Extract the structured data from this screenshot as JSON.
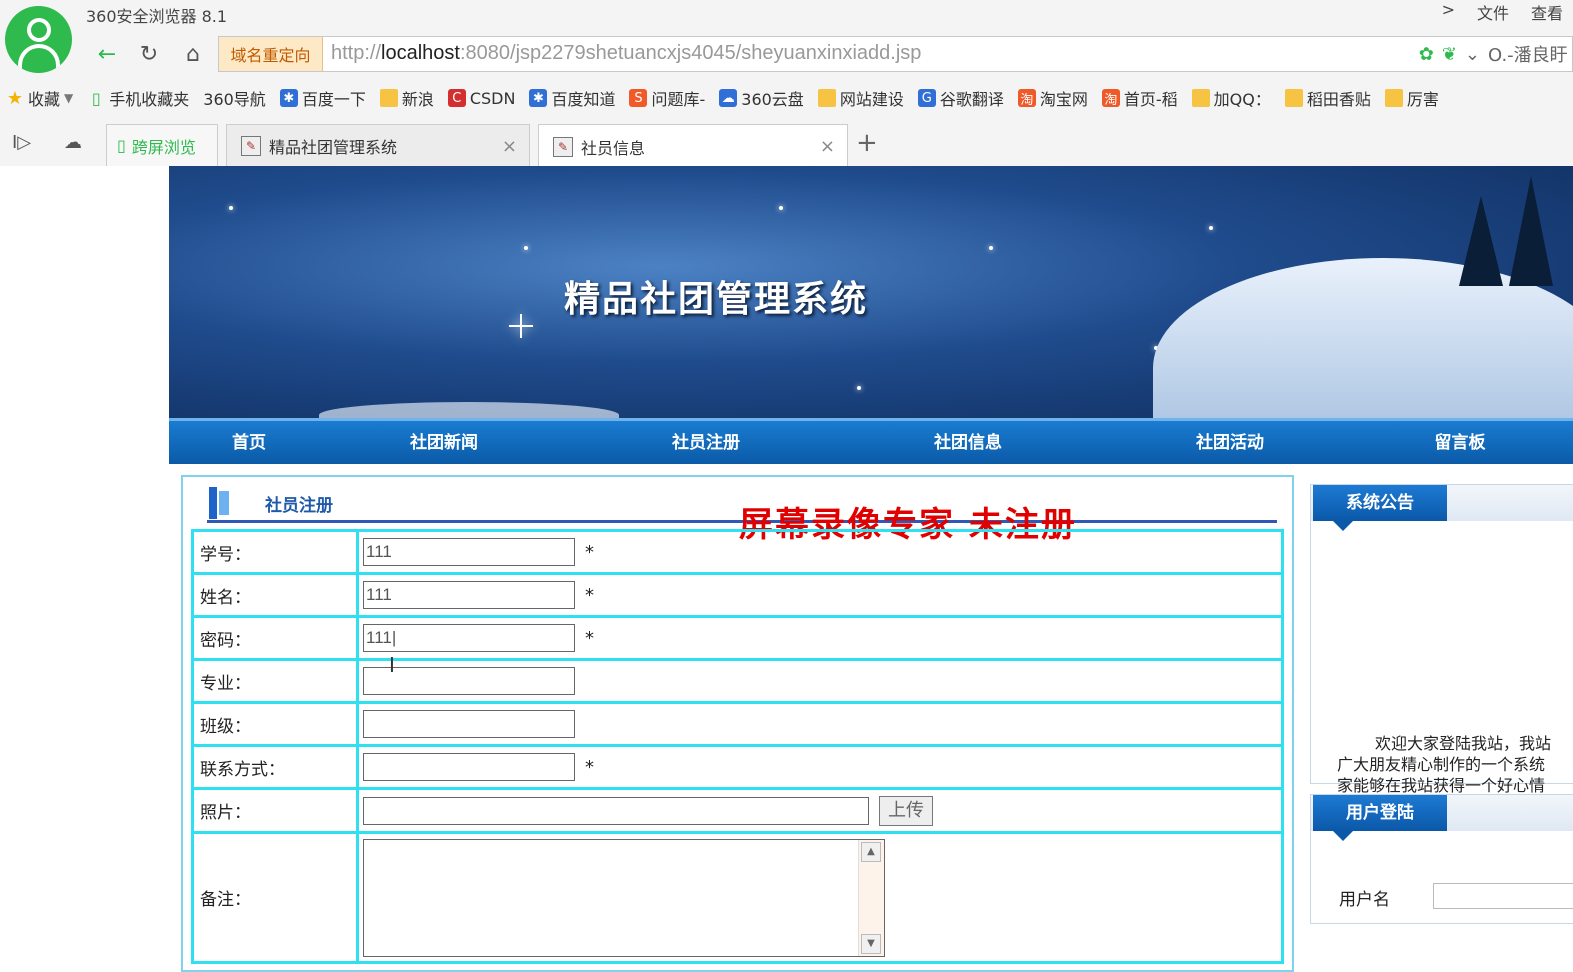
{
  "browser": {
    "title": "360安全浏览器 8.1",
    "menu": [
      ">",
      "文件",
      "查看"
    ],
    "redirect_label": "域名重定向",
    "url_prefix": "http://",
    "url_host": "localhost",
    "url_rest": ":8080/jsp2279shetuancxjs4045/sheyuanxinxiadd.jsp",
    "search_hint": "O.-潘良盱",
    "bookmarks": [
      {
        "label": "收藏",
        "icon": "star-icon"
      },
      {
        "label": "手机收藏夹",
        "icon": "phone-icon"
      },
      {
        "label": "360导航",
        "icon": "page-icon"
      },
      {
        "label": "百度一下",
        "icon": "baidu-icon"
      },
      {
        "label": "新浪",
        "icon": "folder-icon"
      },
      {
        "label": "CSDN",
        "icon": "csdn-icon"
      },
      {
        "label": "百度知道",
        "icon": "baidu-icon"
      },
      {
        "label": "问题库-",
        "icon": "sogou-icon"
      },
      {
        "label": "360云盘",
        "icon": "cloud-icon"
      },
      {
        "label": "网站建设",
        "icon": "folder-icon"
      },
      {
        "label": "谷歌翻译",
        "icon": "translate-icon"
      },
      {
        "label": "淘宝网",
        "icon": "taobao-icon"
      },
      {
        "label": "首页-稻",
        "icon": "taobao-icon"
      },
      {
        "label": "加QQ：",
        "icon": "folder-icon"
      },
      {
        "label": "稻田香贴",
        "icon": "folder-icon"
      },
      {
        "label": "厉害",
        "icon": "folder-icon"
      }
    ],
    "tabs": [
      {
        "label": "跨屏浏览"
      },
      {
        "label": "精品社团管理系统"
      },
      {
        "label": "社员信息"
      }
    ]
  },
  "site": {
    "title": "精品社团管理系统",
    "nav": [
      "首页",
      "社团新闻",
      "社员注册",
      "社团信息",
      "社团活动",
      "留言板"
    ],
    "section_title": "社员注册",
    "watermark": "屏幕录像专家 未注册"
  },
  "form": {
    "rows": [
      {
        "label": "学号：",
        "value": "111",
        "required": "*"
      },
      {
        "label": "姓名：",
        "value": "111",
        "required": "*"
      },
      {
        "label": "密码：",
        "value": "111|",
        "required": "*"
      },
      {
        "label": "专业：",
        "value": "",
        "required": ""
      },
      {
        "label": "班级：",
        "value": "",
        "required": ""
      },
      {
        "label": "联系方式：",
        "value": "",
        "required": "*"
      }
    ],
    "photo_label": "照片：",
    "upload_label": "上传",
    "notes_label": "备注："
  },
  "sidebar": {
    "notice_title": "系统公告",
    "notice_lines": [
      "欢迎大家登陆我站，我站",
      "广大朋友精心制作的一个系统",
      "家能够在我站获得一个好心情"
    ],
    "login_title": "用户登陆",
    "username_label": "用户名"
  }
}
